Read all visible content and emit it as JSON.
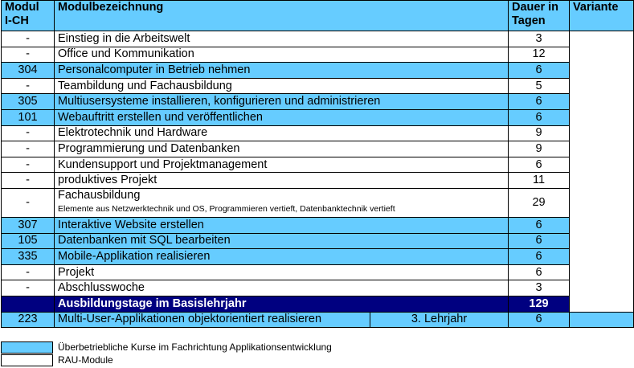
{
  "headers": {
    "modul": "Modul I-CH",
    "modul_line1": "Modul",
    "modul_line2": "I-CH",
    "bezeichnung": "Modulbezeichnung",
    "dauer_line1": "Dauer in",
    "dauer_line2": "Tagen",
    "variante": "Variante"
  },
  "rows": [
    {
      "modul": "-",
      "name": "Einstieg in die Arbeitswelt",
      "days": "3",
      "type": "rau"
    },
    {
      "modul": "-",
      "name": "Office und Kommunikation",
      "days": "12",
      "type": "rau"
    },
    {
      "modul": "304",
      "name": "Personalcomputer in Betrieb nehmen",
      "days": "6",
      "type": "uek"
    },
    {
      "modul": "-",
      "name": "Teambildung und Fachausbildung",
      "days": "5",
      "type": "rau"
    },
    {
      "modul": "305",
      "name": "Multiusersysteme installieren, konfigurieren und administrieren",
      "days": "6",
      "type": "uek"
    },
    {
      "modul": "101",
      "name": "Webauftritt erstellen und veröffentlichen",
      "days": "6",
      "type": "uek"
    },
    {
      "modul": "-",
      "name": "Elektrotechnik und Hardware",
      "days": "9",
      "type": "rau"
    },
    {
      "modul": "-",
      "name": "Programmierung und Datenbanken",
      "days": "9",
      "type": "rau"
    },
    {
      "modul": "-",
      "name": "Kundensupport und Projektmanagement",
      "days": "6",
      "type": "rau"
    },
    {
      "modul": "-",
      "name": "produktives Projekt",
      "days": "11",
      "type": "rau"
    },
    {
      "modul": "-",
      "name": "Fachausbildung",
      "sub": "Elemente aus Netzwerktechnik und OS, Programmieren vertieft, Datenbanktechnik vertieft",
      "days": "29",
      "type": "rau"
    },
    {
      "modul": "307",
      "name": "Interaktive Website erstellen",
      "days": "6",
      "type": "uek"
    },
    {
      "modul": "105",
      "name": "Datenbanken mit SQL bearbeiten",
      "days": "6",
      "type": "uek"
    },
    {
      "modul": "335",
      "name": "Mobile-Applikation realisieren",
      "days": "6",
      "type": "uek"
    },
    {
      "modul": "-",
      "name": "Projekt",
      "days": "6",
      "type": "rau"
    },
    {
      "modul": "-",
      "name": "Abschlusswoche",
      "days": "3",
      "type": "rau"
    }
  ],
  "total": {
    "label": "Ausbildungstage im Basislehrjahr",
    "days": "129"
  },
  "variant_label": "Basislehrjahr",
  "last_row": {
    "modul": "223",
    "name": "Multi-User-Applikationen objektorientiert realisieren",
    "year": "3. Lehrjahr",
    "days": "6"
  },
  "legend": {
    "uek": "Überbetriebliche Kurse im Fachrichtung Applikationsentwicklung",
    "rau": "RAU-Module"
  },
  "colors": {
    "uek": "#66ccff",
    "navy": "#000080"
  }
}
